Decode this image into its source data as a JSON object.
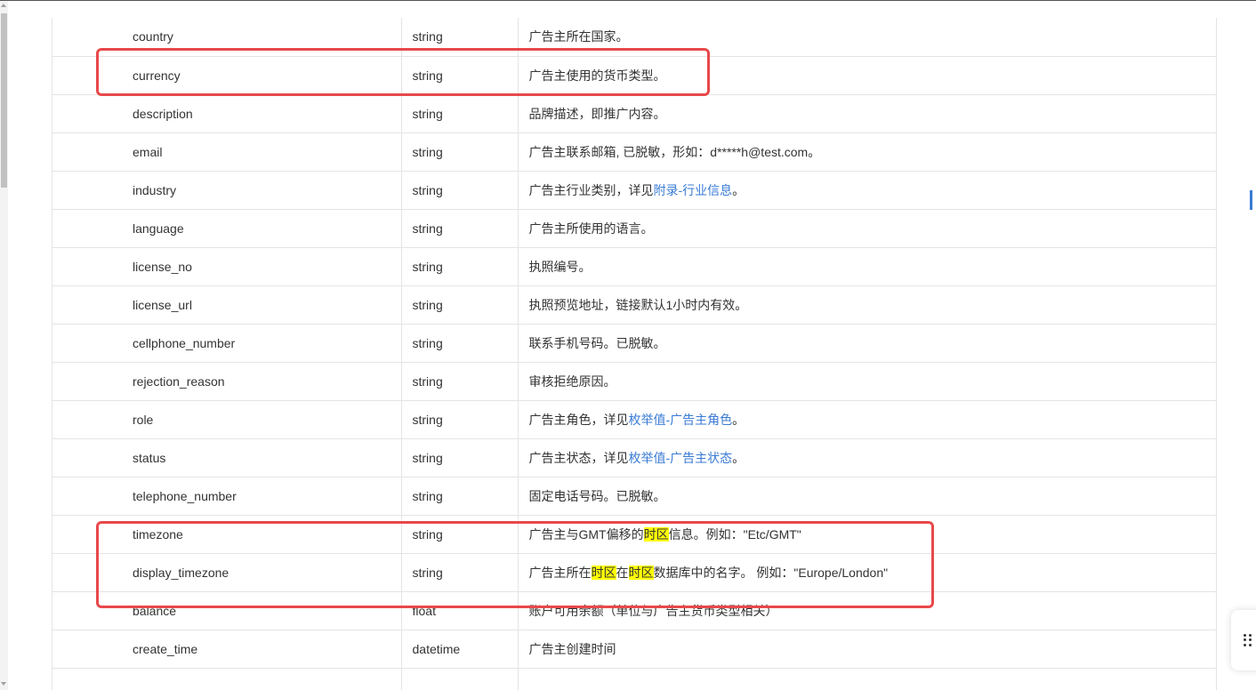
{
  "rows": [
    {
      "name": "country",
      "type": "string",
      "desc": [
        {
          "t": "广告主所在国家。"
        }
      ]
    },
    {
      "name": "currency",
      "type": "string",
      "desc": [
        {
          "t": "广告主使用的货币类型。"
        }
      ]
    },
    {
      "name": "description",
      "type": "string",
      "desc": [
        {
          "t": "品牌描述，即推广内容。"
        }
      ]
    },
    {
      "name": "email",
      "type": "string",
      "desc": [
        {
          "t": "广告主联系邮箱, 已脱敏，形如：d*****h@test.com。"
        }
      ]
    },
    {
      "name": "industry",
      "type": "string",
      "desc": [
        {
          "t": "广告主行业类别，详见"
        },
        {
          "t": "附录-行业信息",
          "link": true
        },
        {
          "t": "。"
        }
      ]
    },
    {
      "name": "language",
      "type": "string",
      "desc": [
        {
          "t": "广告主所使用的语言。"
        }
      ]
    },
    {
      "name": "license_no",
      "type": "string",
      "desc": [
        {
          "t": "执照编号。"
        }
      ]
    },
    {
      "name": "license_url",
      "type": "string",
      "desc": [
        {
          "t": "执照预览地址，链接默认1小时内有效。"
        }
      ]
    },
    {
      "name": "cellphone_number",
      "type": "string",
      "desc": [
        {
          "t": "联系手机号码。已脱敏。"
        }
      ]
    },
    {
      "name": "rejection_reason",
      "type": "string",
      "desc": [
        {
          "t": "审核拒绝原因。"
        }
      ]
    },
    {
      "name": "role",
      "type": "string",
      "desc": [
        {
          "t": "广告主角色，详见"
        },
        {
          "t": "枚举值-广告主角色",
          "link": true
        },
        {
          "t": "。"
        }
      ]
    },
    {
      "name": "status",
      "type": "string",
      "desc": [
        {
          "t": "广告主状态，详见"
        },
        {
          "t": "枚举值-广告主状态",
          "link": true
        },
        {
          "t": "。"
        }
      ]
    },
    {
      "name": "telephone_number",
      "type": "string",
      "desc": [
        {
          "t": "固定电话号码。已脱敏。"
        }
      ]
    },
    {
      "name": "timezone",
      "type": "string",
      "desc": [
        {
          "t": "广告主与GMT偏移的"
        },
        {
          "t": "时区",
          "hl": true
        },
        {
          "t": "信息。例如：\"Etc/GMT\""
        }
      ]
    },
    {
      "name": "display_timezone",
      "type": "string",
      "desc": [
        {
          "t": "广告主所在"
        },
        {
          "t": "时区",
          "hl": true
        },
        {
          "t": "在"
        },
        {
          "t": "时区",
          "hl": true
        },
        {
          "t": "数据库中的名字。 例如：\"Europe/London\""
        }
      ]
    },
    {
      "name": "balance",
      "type": "float",
      "desc": [
        {
          "t": "账户可用余额（单位与广告主货币类型相关）"
        }
      ]
    },
    {
      "name": "create_time",
      "type": "datetime",
      "desc": [
        {
          "t": "广告主创建时间"
        }
      ]
    },
    {
      "name": "",
      "type": "",
      "desc": []
    }
  ],
  "colors": {
    "annotation": "#e8484b",
    "link": "#3a7bd5",
    "highlight": "#ffff00",
    "border": "#e4e4e4"
  },
  "icons": {
    "widget": "drag-grip-icon"
  }
}
